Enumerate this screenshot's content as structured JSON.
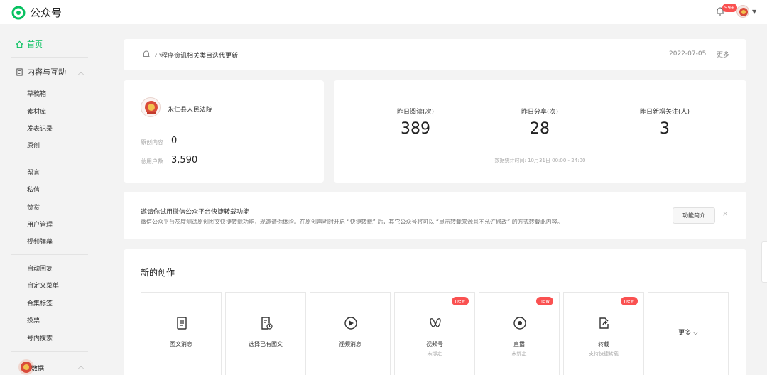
{
  "app": {
    "title": "公众号",
    "notification_count": "99+"
  },
  "colors": {
    "brand": "#07c160",
    "badge": "#fa5151",
    "background": "#f3f3f3"
  },
  "sidebar": {
    "home": "首页",
    "group_content": "内容与互动",
    "items_a": [
      "草稿箱",
      "素材库",
      "发表记录",
      "原创"
    ],
    "items_b": [
      "留言",
      "私信",
      "赞赏",
      "用户管理",
      "视频弹幕"
    ],
    "items_c": [
      "自动回复",
      "自定义菜单",
      "合集标签",
      "投票",
      "号内搜索"
    ],
    "group_data": "数据"
  },
  "notice": {
    "text": "小程序资讯相关类目迭代更新",
    "date": "2022-07-05",
    "more": "更多"
  },
  "account": {
    "name": "永仁县人民法院",
    "original_label": "原创内容",
    "original_value": "0",
    "users_label": "总用户数",
    "users_value": "3,590"
  },
  "stats": {
    "items": [
      {
        "label": "昨日阅读(次)",
        "value": "389"
      },
      {
        "label": "昨日分享(次)",
        "value": "28"
      },
      {
        "label": "昨日新增关注(人)",
        "value": "3"
      }
    ],
    "time_note": "数据统计时间: 10月31日 00:00 - 24:00"
  },
  "invite": {
    "title": "邀请你试用微信公众平台快捷转载功能",
    "desc": "微信公众平台灰度测试原创图文快捷转载功能，现邀请你体验。在原创声明时开启 “快捷转载” 后，其它公众号将可以 “显示转载来源且不允许修改” 的方式转载此内容。",
    "button": "功能简介",
    "close": "×"
  },
  "creation": {
    "title": "新的创作",
    "tiles": [
      {
        "label": "图文消息",
        "icon": "document-icon"
      },
      {
        "label": "选择已有图文",
        "icon": "document-clock-icon"
      },
      {
        "label": "视频消息",
        "icon": "play-icon"
      },
      {
        "label": "视频号",
        "sub": "未绑定",
        "badge": "new",
        "icon": "channels-icon"
      },
      {
        "label": "直播",
        "sub": "未绑定",
        "badge": "new",
        "icon": "live-icon"
      },
      {
        "label": "转载",
        "sub": "支持快捷转载",
        "badge": "new",
        "icon": "repost-icon"
      }
    ],
    "more": "更多 ⌵"
  }
}
